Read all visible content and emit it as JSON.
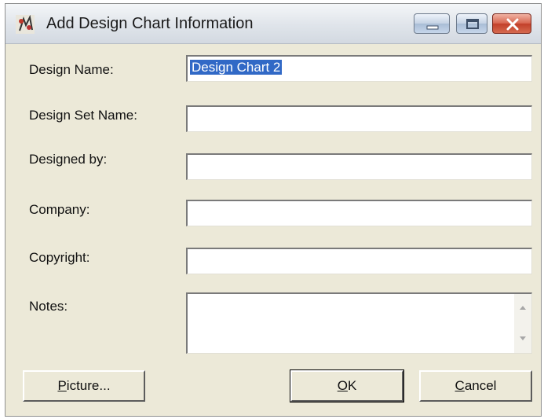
{
  "window": {
    "title": "Add Design Chart Information"
  },
  "form": {
    "design_name": {
      "label": "Design Name:",
      "value": "Design Chart 2"
    },
    "design_set_name": {
      "label": "Design Set Name:",
      "value": ""
    },
    "designed_by": {
      "label": "Designed by:",
      "value": ""
    },
    "company": {
      "label": "Company:",
      "value": ""
    },
    "copyright": {
      "label": "Copyright:",
      "value": ""
    },
    "notes": {
      "label": "Notes:",
      "value": ""
    }
  },
  "buttons": {
    "picture": {
      "mnemonic": "P",
      "rest": "icture..."
    },
    "ok": {
      "mnemonic": "O",
      "rest": "K"
    },
    "cancel": {
      "mnemonic": "C",
      "rest": "ancel"
    }
  },
  "icons": {
    "app": "app-icon",
    "minimize": "minimize-icon",
    "maximize": "maximize-icon",
    "close": "close-icon",
    "scroll_up": "scroll-up-icon",
    "scroll_down": "scroll-down-icon"
  }
}
